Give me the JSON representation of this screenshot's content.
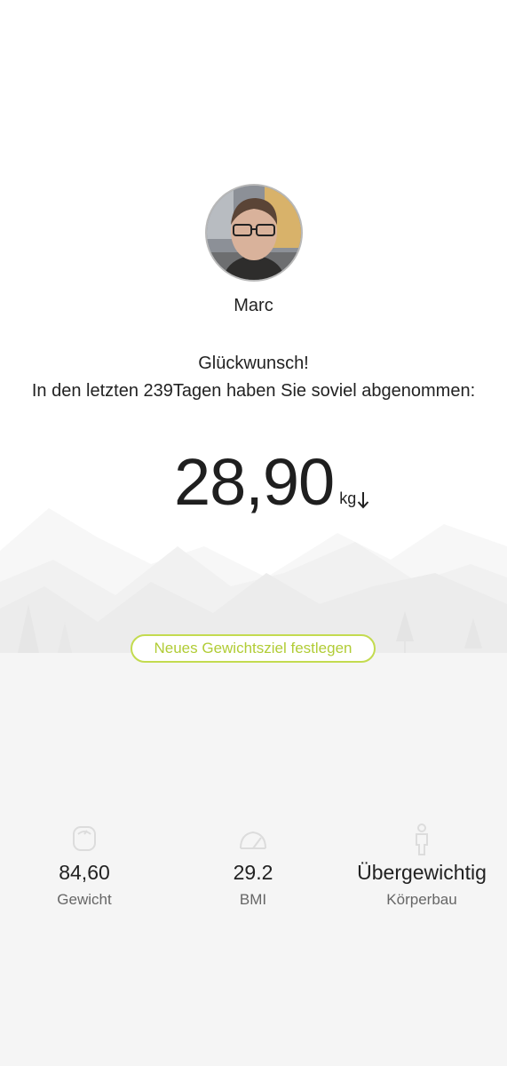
{
  "user": {
    "name": "Marc"
  },
  "message": {
    "title": "Glückwunsch!",
    "subtitle": "In den letzten 239Tagen haben Sie soviel abgenommen:"
  },
  "weight_loss": {
    "value": "28,90",
    "unit": "kg",
    "trend_icon": "arrow-down-icon"
  },
  "goal_button": {
    "label": "Neues Gewichtsziel festlegen"
  },
  "stats": [
    {
      "value": "84,60",
      "label": "Gewicht",
      "icon": "scale-icon"
    },
    {
      "value": "29.2",
      "label": "BMI",
      "icon": "bmi-gauge-icon"
    },
    {
      "value": "Übergewichtig",
      "label": "Körperbau",
      "icon": "body-figure-icon"
    }
  ],
  "colors": {
    "accent": "#b1cc36",
    "accent_border": "#c3db4f",
    "panel_bg": "#f5f5f5",
    "text_primary": "#222222",
    "text_secondary": "#666666"
  }
}
